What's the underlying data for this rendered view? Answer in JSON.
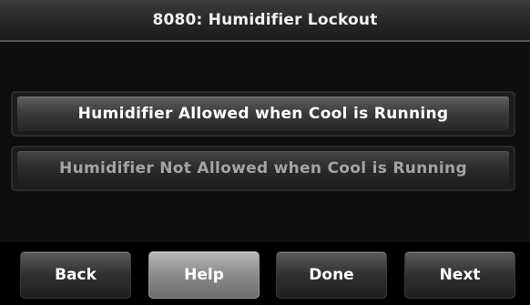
{
  "header": {
    "title": "8080: Humidifier Lockout"
  },
  "options": [
    {
      "label": "Humidifier Allowed when Cool is Running",
      "selected": true
    },
    {
      "label": "Humidifier Not Allowed when Cool is Running",
      "selected": false
    }
  ],
  "footer": {
    "back_label": "Back",
    "help_label": "Help",
    "done_label": "Done",
    "next_label": "Next"
  }
}
